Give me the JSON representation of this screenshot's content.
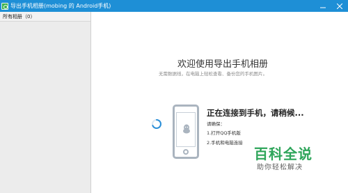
{
  "window": {
    "title": "导出手机相册(mobing 的 Android手机)",
    "titlebar_color": "#1e8fd6"
  },
  "sidebar": {
    "header": "所有相册（0）"
  },
  "welcome": {
    "title": "欢迎使用导出手机相册",
    "subtitle": "无需数据线，在电脑上轻松查看、备份您的手机图片。"
  },
  "connection": {
    "status": "正在连接到手机，请稍候...",
    "note_label": "请确保：",
    "step1": "1.打开QQ手机版",
    "step2": "2.手机和电脑连接"
  },
  "watermark": {
    "title": "百科全说",
    "subtitle": "助你轻松解决",
    "color": "#2ea55a"
  },
  "icons": {
    "app": "album-app-icon",
    "minimize": "minimize-icon",
    "close": "close-icon",
    "spinner": "loading-spinner-icon",
    "phone": "phone-icon",
    "qq": "qq-icon"
  }
}
